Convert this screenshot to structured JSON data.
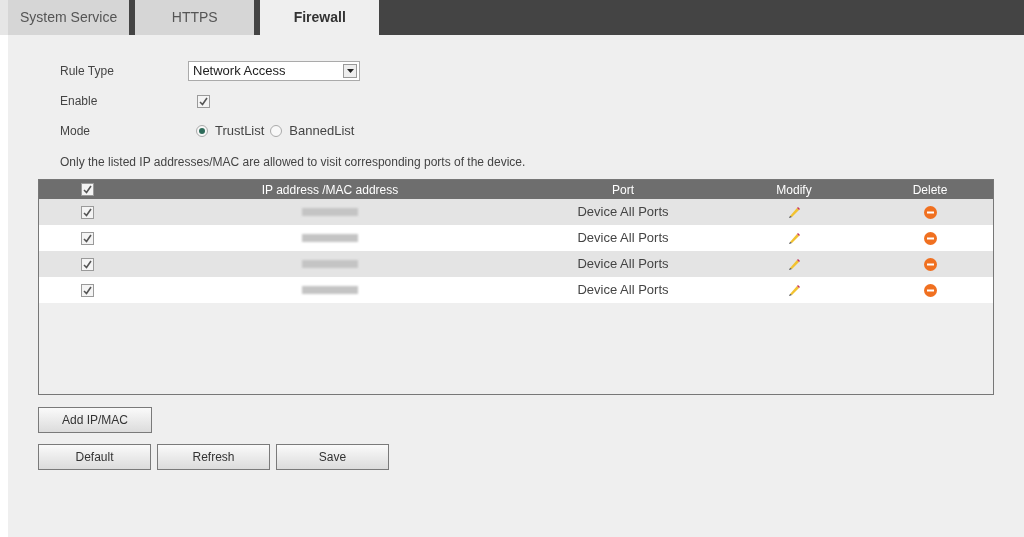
{
  "tabs": [
    {
      "label": "System Service",
      "selected": false
    },
    {
      "label": "HTTPS",
      "selected": false
    },
    {
      "label": "Firewall",
      "selected": true
    }
  ],
  "form": {
    "rule_type": {
      "label": "Rule Type",
      "value": "Network Access"
    },
    "enable": {
      "label": "Enable",
      "checked": true
    },
    "mode": {
      "label": "Mode",
      "options": [
        {
          "label": "TrustList",
          "selected": true
        },
        {
          "label": "BannedList",
          "selected": false
        }
      ]
    }
  },
  "note": "Only the listed IP addresses/MAC are allowed to visit corresponding ports of the device.",
  "table": {
    "select_all_checked": true,
    "columns": [
      "IP address /MAC address",
      "Port",
      "Modify",
      "Delete"
    ],
    "rows": [
      {
        "checked": true,
        "port": "Device All Ports"
      },
      {
        "checked": true,
        "port": "Device All Ports"
      },
      {
        "checked": true,
        "port": "Device All Ports"
      },
      {
        "checked": true,
        "port": "Device All Ports"
      }
    ]
  },
  "buttons": {
    "add": "Add IP/MAC",
    "actions": [
      "Default",
      "Refresh",
      "Save"
    ]
  }
}
